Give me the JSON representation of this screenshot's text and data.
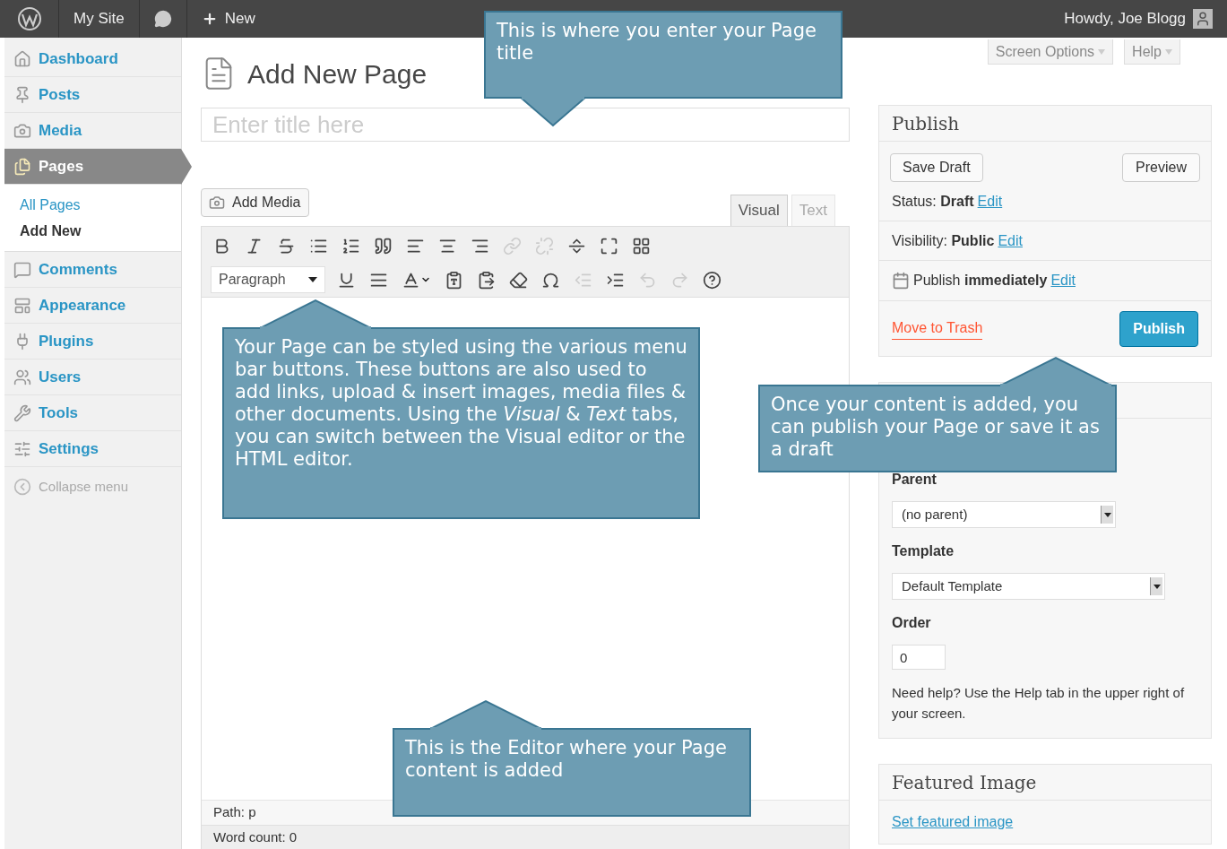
{
  "admin_bar": {
    "site": "My Site",
    "new": "New",
    "greeting": "Howdy, Joe Blogg"
  },
  "sidebar": {
    "items": [
      {
        "kind": "dashboard",
        "label": "Dashboard",
        "selected": false
      },
      {
        "kind": "posts",
        "label": "Posts",
        "selected": false
      },
      {
        "kind": "media",
        "label": "Media",
        "selected": false
      },
      {
        "kind": "pages",
        "label": "Pages",
        "selected": true,
        "children": [
          {
            "label": "All Pages",
            "selected": false
          },
          {
            "label": "Add New",
            "selected": true
          }
        ]
      },
      {
        "kind": "comments",
        "label": "Comments",
        "selected": false
      },
      {
        "kind": "appearance",
        "label": "Appearance",
        "selected": false
      },
      {
        "kind": "plugins",
        "label": "Plugins",
        "selected": false
      },
      {
        "kind": "users",
        "label": "Users",
        "selected": false
      },
      {
        "kind": "tools",
        "label": "Tools",
        "selected": false
      },
      {
        "kind": "settings",
        "label": "Settings",
        "selected": false
      }
    ],
    "collapse": "Collapse menu"
  },
  "screen_meta": [
    "Screen Options",
    "Help"
  ],
  "page_title": "Add New Page",
  "title_field": {
    "placeholder": "Enter title here"
  },
  "add_media": "Add Media",
  "editor_tabs": [
    {
      "label": "Visual",
      "selected": true
    },
    {
      "label": "Text",
      "selected": false
    }
  ],
  "toolbar_rows": [
    [
      {
        "kind": "bold",
        "disabled": false
      },
      {
        "kind": "italic",
        "disabled": false
      },
      {
        "kind": "strikethrough",
        "disabled": false
      },
      {
        "kind": "bullets",
        "disabled": false
      },
      {
        "kind": "numbers",
        "disabled": false
      },
      {
        "kind": "quote",
        "disabled": false
      },
      {
        "kind": "alignleft",
        "disabled": false
      },
      {
        "kind": "aligncenter",
        "disabled": false
      },
      {
        "kind": "alignright",
        "disabled": false
      },
      {
        "kind": "link",
        "disabled": true
      },
      {
        "kind": "unlink",
        "disabled": true
      },
      {
        "kind": "more",
        "disabled": false
      },
      {
        "kind": "fullscreen",
        "disabled": false
      },
      {
        "kind": "kitchensink",
        "disabled": false
      }
    ],
    [
      {
        "kind": "underline",
        "disabled": false
      },
      {
        "kind": "justify",
        "disabled": false
      },
      {
        "kind": "textcolor",
        "disabled": false
      },
      {
        "kind": "pastetext",
        "disabled": false
      },
      {
        "kind": "pasteword",
        "disabled": false
      },
      {
        "kind": "eraser",
        "disabled": false
      },
      {
        "kind": "omega",
        "disabled": false
      },
      {
        "kind": "outdent",
        "disabled": true
      },
      {
        "kind": "indent",
        "disabled": false
      },
      {
        "kind": "undo",
        "disabled": true
      },
      {
        "kind": "redo",
        "disabled": true
      },
      {
        "kind": "help",
        "disabled": false
      }
    ]
  ],
  "format_select": "Paragraph",
  "path": "Path: p",
  "word_count": "Word count: 0",
  "publish": {
    "title": "Publish",
    "save_draft": "Save Draft",
    "preview": "Preview",
    "rows": [
      {
        "kind": "status",
        "label": "Status:",
        "value": "Draft",
        "link": "Edit"
      },
      {
        "kind": "visibility",
        "label": "Visibility:",
        "value": "Public",
        "link": "Edit"
      },
      {
        "kind": "schedule",
        "label": "Publish",
        "value": "immediately",
        "link": "Edit"
      }
    ],
    "trash": "Move to Trash",
    "publish_button": "Publish"
  },
  "page_attributes": {
    "parent_label": "Parent",
    "parent": "(no parent)",
    "template_label": "Template",
    "template": "Default Template",
    "order_label": "Order",
    "order": "0",
    "help": "Need help? Use the Help tab in the upper right of your screen."
  },
  "featured_image": {
    "title": "Featured Image",
    "link": "Set featured image"
  },
  "callouts": [
    {
      "kind": "title",
      "text": "This is where you enter your Page title"
    },
    {
      "kind": "toolbar",
      "text": "Your Page can be styled using the various menu bar buttons. These buttons are also used to add links, upload & insert images, media files & other documents. Using the *Visual* & *Text* tabs, you can switch between the Visual editor or the HTML editor."
    },
    {
      "kind": "publish",
      "text": "Once your content is added, you can publish your Page or save it as a draft"
    },
    {
      "kind": "editor",
      "text": "This is the Editor where your Page content is added"
    }
  ]
}
